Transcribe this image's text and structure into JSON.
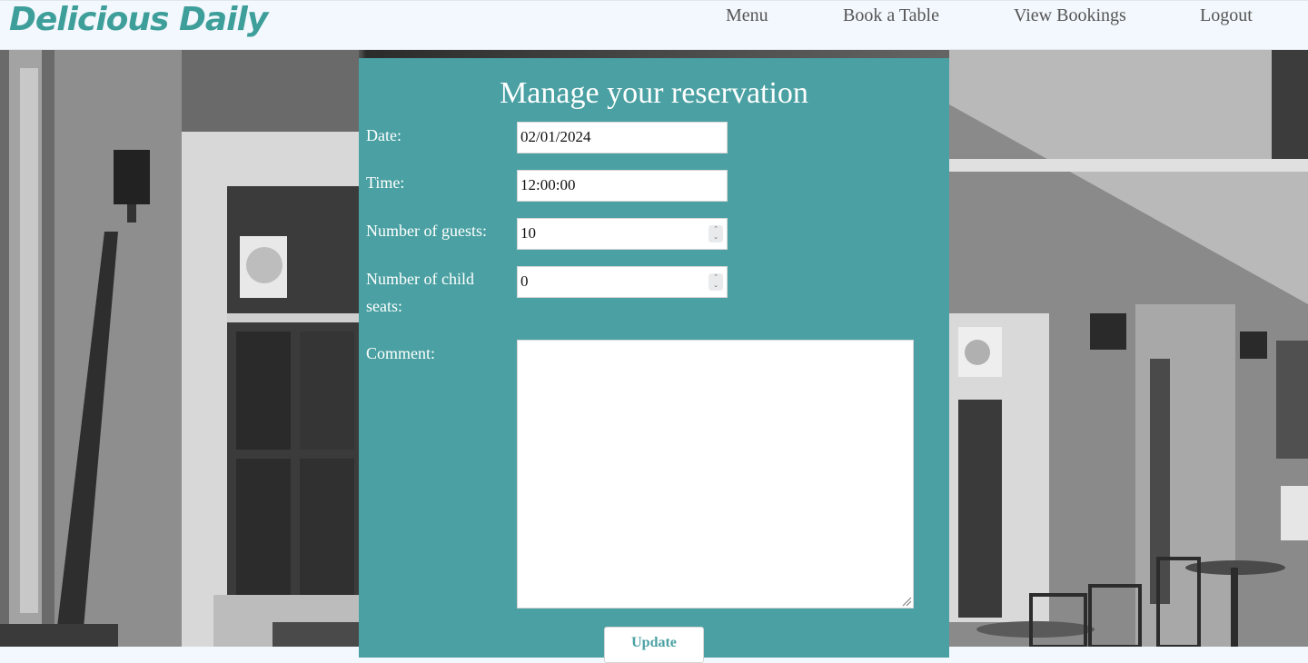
{
  "brand": "Delicious Daily",
  "nav": {
    "menu": "Menu",
    "book": "Book a Table",
    "bookings": "View Bookings",
    "logout": "Logout"
  },
  "form": {
    "title": "Manage your reservation",
    "date_label": "Date:",
    "date_value": "02/01/2024",
    "time_label": "Time:",
    "time_value": "12:00:00",
    "guests_label": "Number of guests:",
    "guests_value": "10",
    "child_seats_label": "Number of child seats:",
    "child_seats_value": "0",
    "comment_label": "Comment:",
    "comment_value": "",
    "update_label": "Update"
  },
  "colors": {
    "accent": "#4aa0a2",
    "brand": "#3e9e9a",
    "nav_bg": "#f2f8fd"
  }
}
